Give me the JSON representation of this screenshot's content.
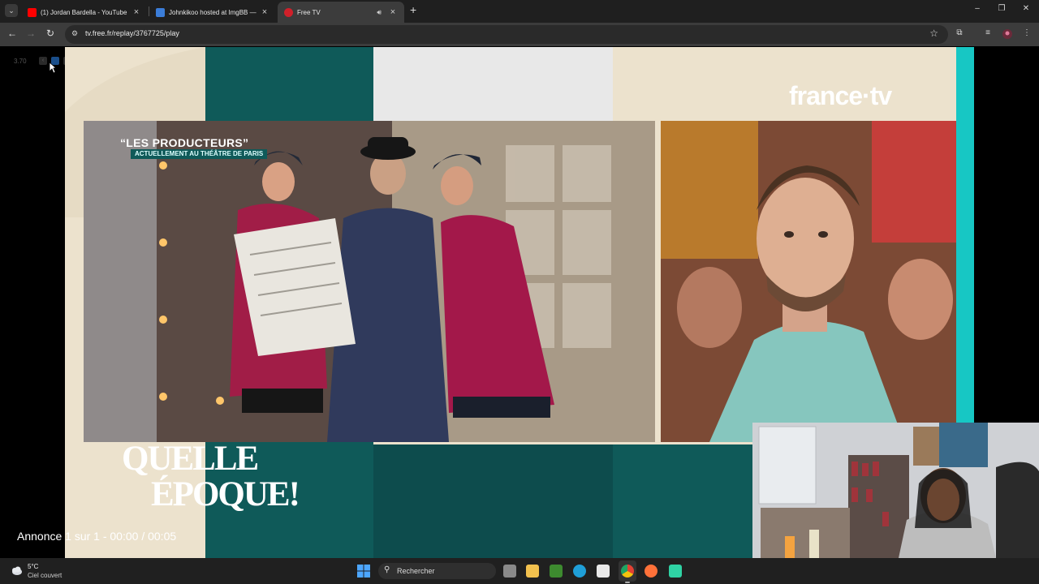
{
  "browser": {
    "tabs": [
      {
        "title": "(1) Jordan Bardella - YouTube",
        "favicon_color": "#ff0000",
        "favicon": "youtube-icon"
      },
      {
        "title": "Johnkikoo hosted at ImgBB —",
        "favicon_color": "#3b7dd8",
        "favicon": "imgbb-icon"
      },
      {
        "title": "Free TV",
        "favicon_color": "#d0202a",
        "favicon": "freetv-icon",
        "active": true
      }
    ],
    "url": "tv.free.fr/replay/3767725/play",
    "new_tab": "+",
    "close": "×"
  },
  "player": {
    "speed": "3.70",
    "brand": "france·tv",
    "caption_title": "“LES PRODUCTEURS”",
    "caption_sub": "ACTUELLEMENT AU THÉÂTRE DE PARIS",
    "logo_line1": "QUELLE",
    "logo_line2": "ÉPOQUE!",
    "ad_status": "Annonce 1 sur 1 - 00:00 / 00:05"
  },
  "taskbar": {
    "temp": "5°C",
    "condition": "Ciel couvert",
    "search_label": "Rechercher"
  },
  "colors": {
    "accent_teal": "#0f5a59",
    "accent_cyan": "#17c7c4",
    "cream": "#ece2cd"
  }
}
